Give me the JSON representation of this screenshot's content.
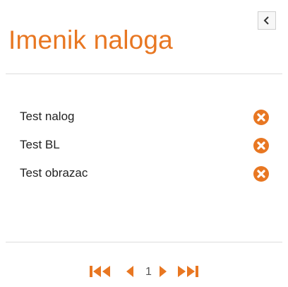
{
  "panel": {
    "title": "Imenik naloga",
    "accent_color": "#e87722",
    "collapse_icon": "chevron-left-icon"
  },
  "accounts": [
    {
      "label": "Test nalog",
      "action_icon": "remove-circle-icon"
    },
    {
      "label": "Test BL",
      "action_icon": "remove-circle-icon"
    },
    {
      "label": "Test obrazac",
      "action_icon": "remove-circle-icon"
    }
  ],
  "pagination": {
    "current_page": "1",
    "first_icon": "first-page-icon",
    "prev_icon": "previous-page-icon",
    "next_icon": "next-page-icon",
    "last_icon": "last-page-icon"
  }
}
